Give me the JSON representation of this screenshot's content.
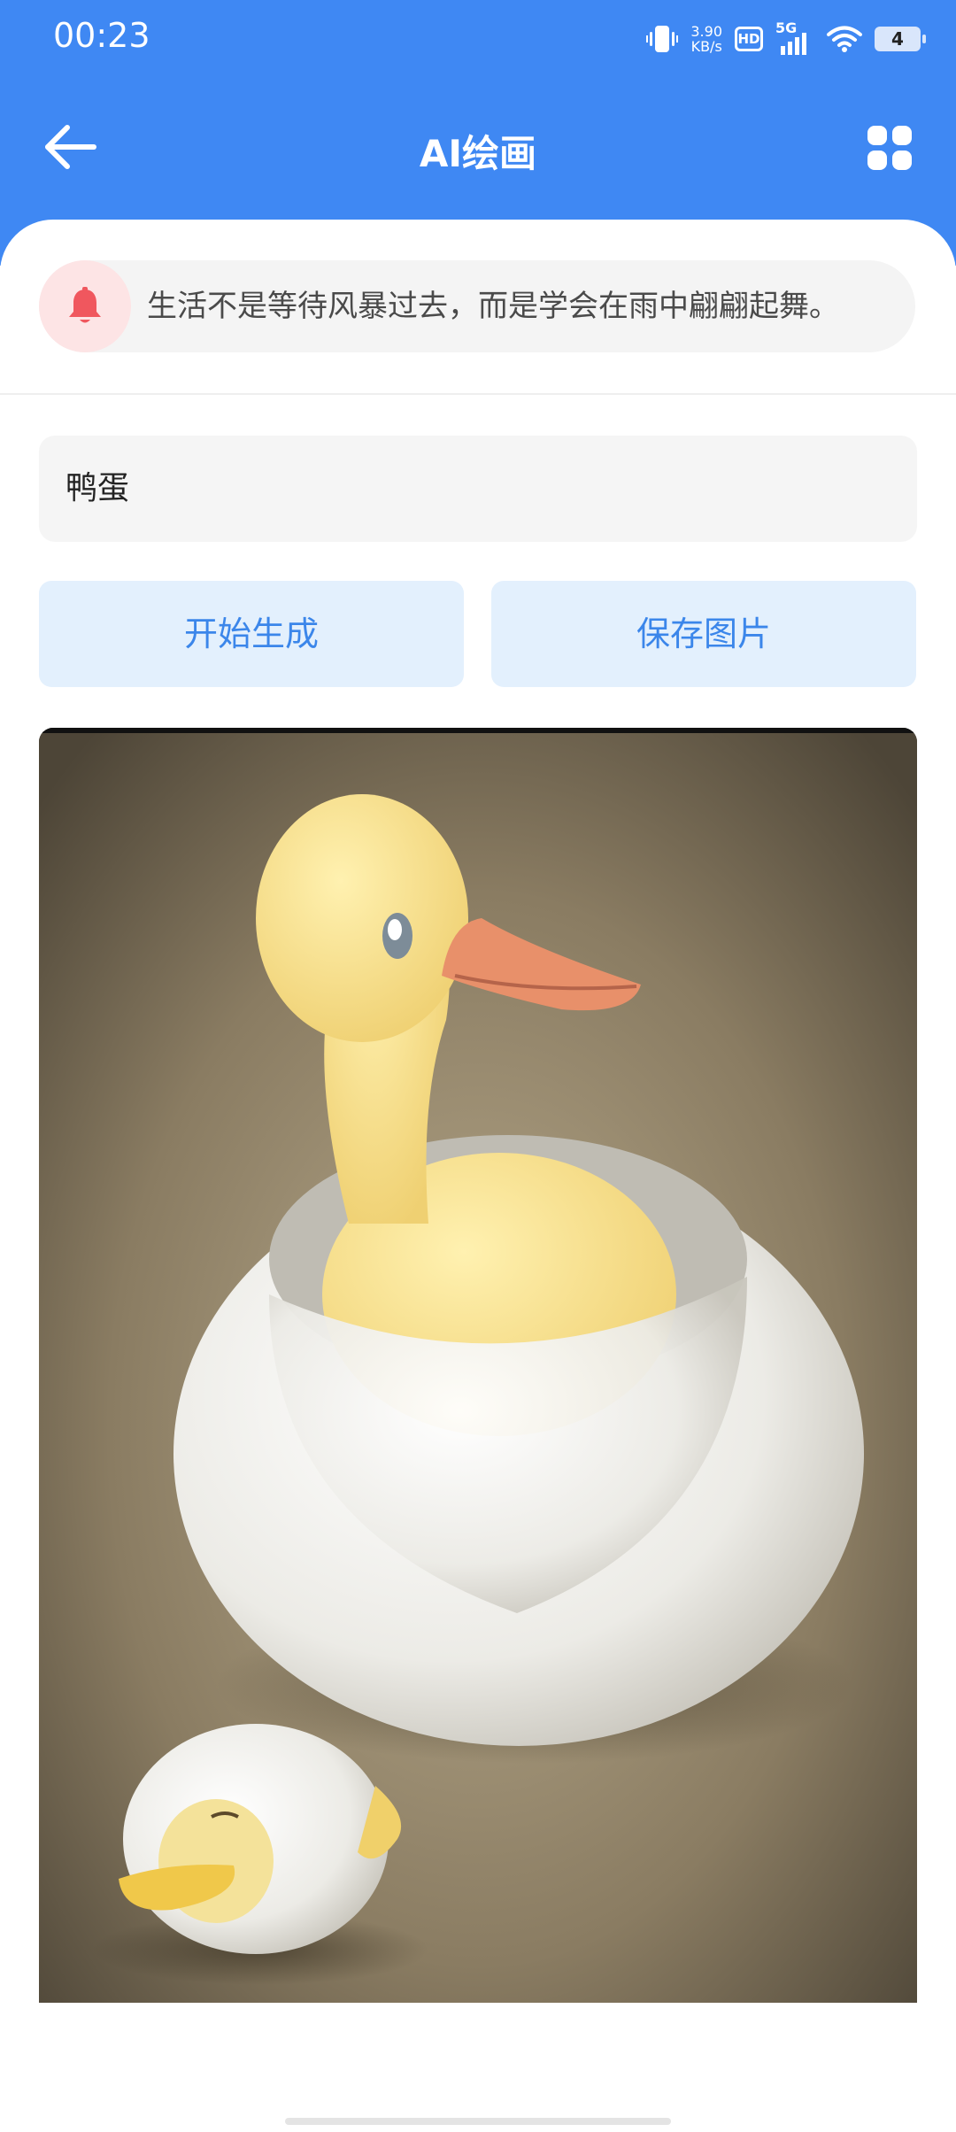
{
  "status_bar": {
    "time": "00:23",
    "speed_value": "3.90",
    "speed_unit": "KB/s",
    "hd": "HD",
    "network": "5G",
    "battery": "4"
  },
  "app_bar": {
    "title": "AI绘画",
    "back_icon": "arrow-left-icon",
    "menu_icon": "grid-icon"
  },
  "notice": {
    "icon": "bell-icon",
    "text": "生活不是等待风暴过去，而是学会在雨中翩翩起舞。"
  },
  "prompt_input": {
    "value": "鸭蛋"
  },
  "buttons": {
    "generate": "开始生成",
    "save": "保存图片"
  },
  "colors": {
    "primary": "#3f88f3",
    "button_bg": "#e3f0fd",
    "button_text": "#3b86ea",
    "bell": "#f0575e"
  }
}
